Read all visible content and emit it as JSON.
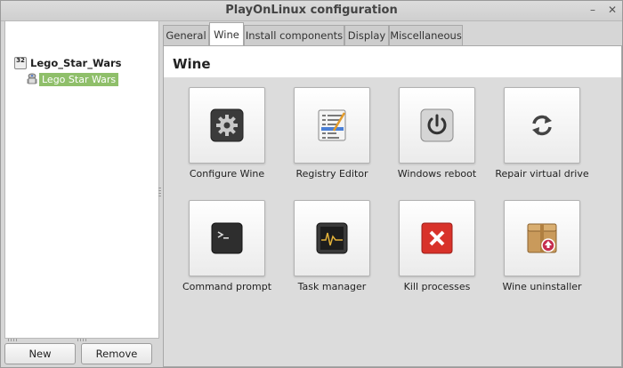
{
  "window": {
    "title": "PlayOnLinux configuration",
    "minimize_glyph": "–",
    "close_glyph": "✕"
  },
  "tree": {
    "root": {
      "badge": "32",
      "label": "Lego_Star_Wars"
    },
    "child": {
      "label": "Lego Star Wars"
    }
  },
  "buttons": {
    "new_label": "New",
    "remove_label": "Remove"
  },
  "tabs": [
    {
      "label": "General"
    },
    {
      "label": "Wine",
      "active": true
    },
    {
      "label": "Install components"
    },
    {
      "label": "Display"
    },
    {
      "label": "Miscellaneous"
    }
  ],
  "panel": {
    "heading": "Wine",
    "tiles": [
      {
        "label": "Configure Wine",
        "icon": "gear-icon"
      },
      {
        "label": "Registry Editor",
        "icon": "registry-icon"
      },
      {
        "label": "Windows reboot",
        "icon": "power-icon"
      },
      {
        "label": "Repair virtual drive",
        "icon": "refresh-icon"
      },
      {
        "label": "Command prompt",
        "icon": "terminal-icon"
      },
      {
        "label": "Task manager",
        "icon": "monitor-icon"
      },
      {
        "label": "Kill processes",
        "icon": "kill-icon"
      },
      {
        "label": "Wine uninstaller",
        "icon": "package-icon"
      }
    ]
  },
  "colors": {
    "selection": "#8fbf6a",
    "kill": "#d8322a"
  }
}
